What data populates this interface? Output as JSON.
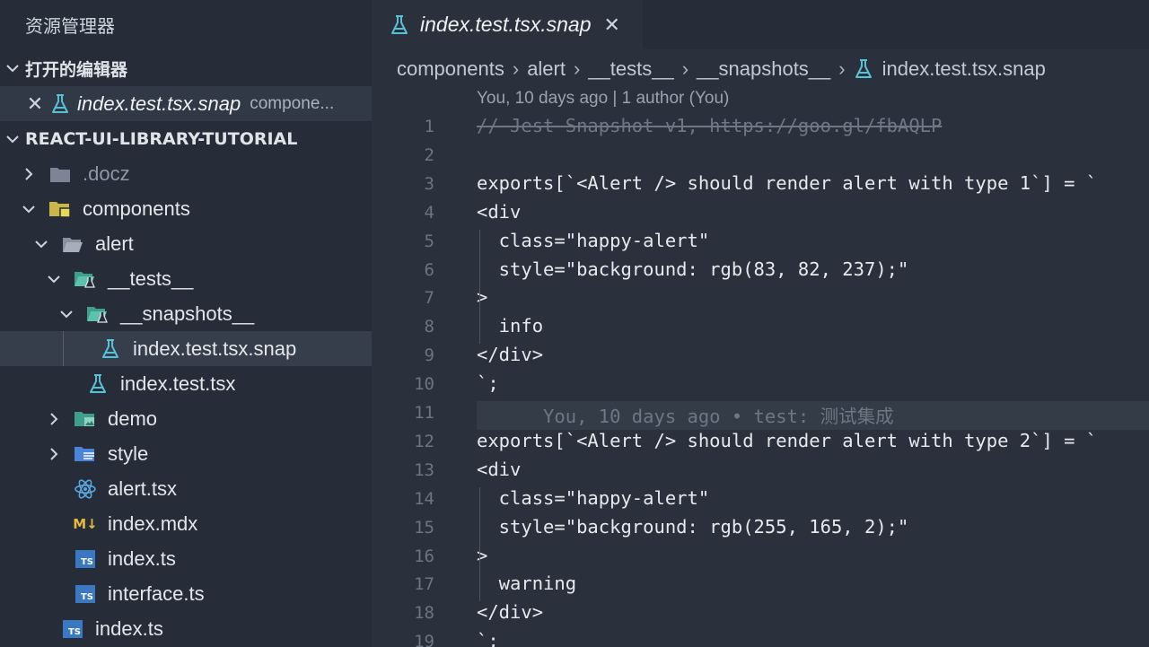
{
  "sidebar": {
    "header_title": "资源管理器",
    "open_editors_title": "打开的编辑器",
    "open_editor": {
      "name": "index.test.tsx.snap",
      "path": "compone..."
    },
    "project_title": "REACT-UI-LIBRARY-TUTORIAL",
    "tree": [
      {
        "label": ".docz",
        "icon": "folder-icon"
      },
      {
        "label": "components",
        "icon": "folder-components-icon"
      },
      {
        "label": "alert",
        "icon": "folder-open-icon"
      },
      {
        "label": "__tests__",
        "icon": "folder-tests-icon"
      },
      {
        "label": "__snapshots__",
        "icon": "folder-tests-icon"
      },
      {
        "label": "index.test.tsx.snap",
        "icon": "flask-icon"
      },
      {
        "label": "index.test.tsx",
        "icon": "flask-icon"
      },
      {
        "label": "demo",
        "icon": "folder-demo-icon"
      },
      {
        "label": "style",
        "icon": "folder-style-icon"
      },
      {
        "label": "alert.tsx",
        "icon": "react-icon"
      },
      {
        "label": "index.mdx",
        "icon": "markdown-icon"
      },
      {
        "label": "index.ts",
        "icon": "typescript-icon"
      },
      {
        "label": "interface.ts",
        "icon": "typescript-icon"
      },
      {
        "label": "index.ts",
        "icon": "typescript-icon"
      }
    ],
    "ts_badge": "TS",
    "md_badge": "M↓"
  },
  "tab": {
    "name": "index.test.tsx.snap",
    "close": "✕"
  },
  "breadcrumb": [
    "components",
    "alert",
    "__tests__",
    "__snapshots__",
    "index.test.tsx.snap"
  ],
  "blame_header": "You, 10 days ago | 1 author (You)",
  "editor": {
    "line_numbers": [
      "1",
      "2",
      "3",
      "4",
      "5",
      "6",
      "7",
      "8",
      "9",
      "10",
      "11",
      "12",
      "13",
      "14",
      "15",
      "16",
      "17",
      "18",
      "19"
    ],
    "lines": [
      "// Jest Snapshot v1, https://goo.gl/fbAQLP",
      "",
      "exports[`<Alert /> should render alert with type 1`] = `",
      "<div",
      "  class=\"happy-alert\"",
      "  style=\"background: rgb(83, 82, 237);\"",
      ">",
      "  info",
      "</div>",
      "`;",
      "      You, 10 days ago • test: 测试集成",
      "exports[`<Alert /> should render alert with type 2`] = `",
      "<div",
      "  class=\"happy-alert\"",
      "  style=\"background: rgb(255, 165, 2);\"",
      ">",
      "  warning",
      "</div>",
      "`;"
    ]
  },
  "colors": {
    "accent_icon": "#56c2d6",
    "folder_icon": "#7d8594"
  }
}
